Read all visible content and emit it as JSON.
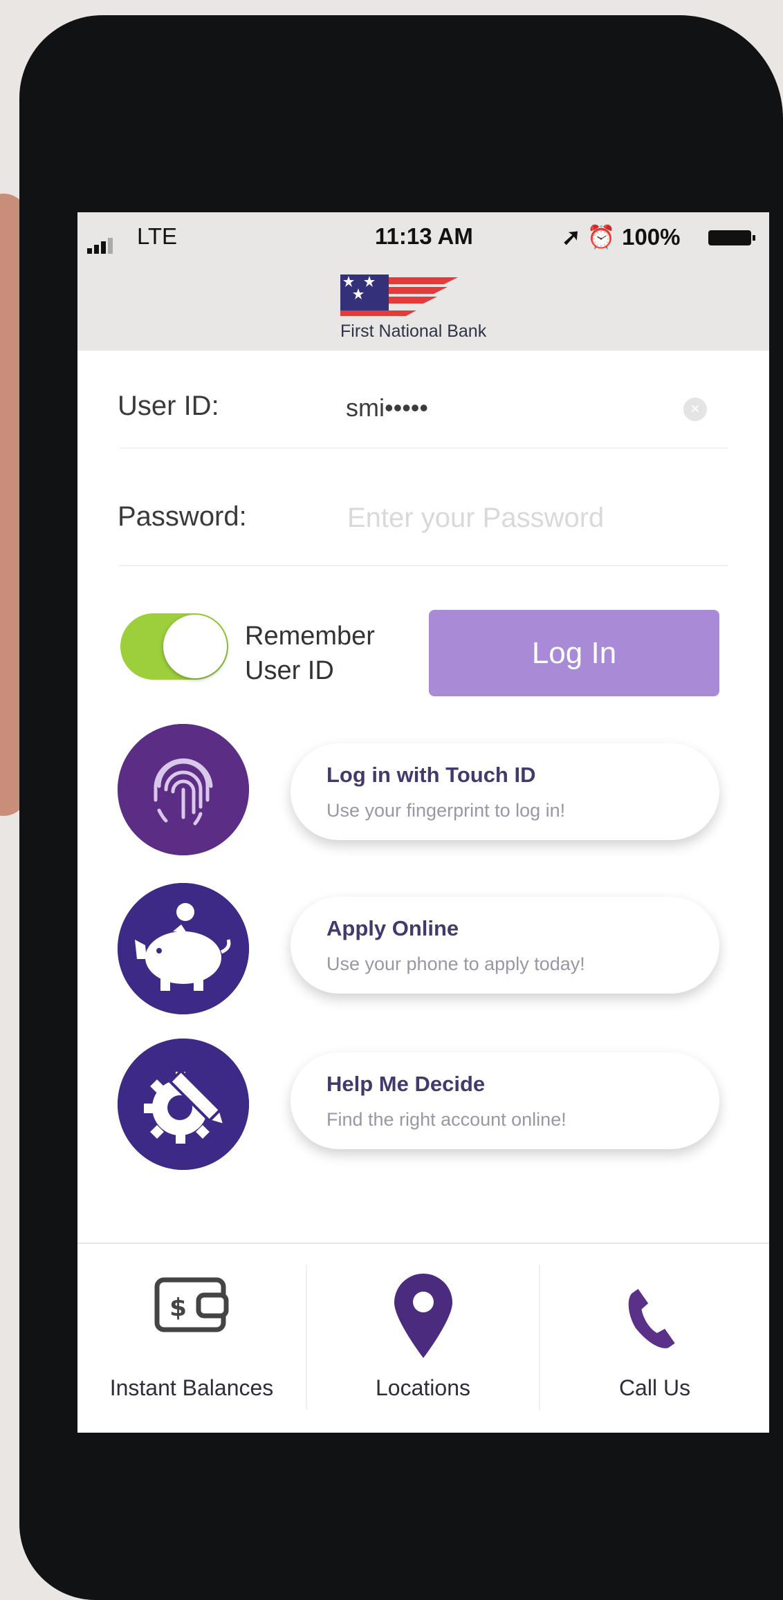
{
  "status_bar": {
    "carrier": "LTE",
    "time": "11:13 AM",
    "battery": "100%"
  },
  "header": {
    "bank_name": "First National Bank"
  },
  "login": {
    "user_id_label": "User ID:",
    "user_id_value": "smi•••••",
    "password_label": "Password:",
    "password_placeholder": "Enter your Password",
    "remember_line1": "Remember",
    "remember_line2": "User ID",
    "remember_on": true,
    "login_button": "Log In"
  },
  "features": [
    {
      "title": "Log in with Touch ID",
      "subtitle": "Use your fingerprint to log in!",
      "icon": "fingerprint-icon"
    },
    {
      "title": "Apply Online",
      "subtitle": "Use your phone to apply today!",
      "icon": "piggy-bank-icon"
    },
    {
      "title": "Help Me Decide",
      "subtitle": "Find the right account online!",
      "icon": "gear-pencil-icon"
    }
  ],
  "tabbar": {
    "items": [
      {
        "label": "Instant Balances",
        "icon": "wallet-icon"
      },
      {
        "label": "Locations",
        "icon": "location-pin-icon"
      },
      {
        "label": "Call Us",
        "icon": "phone-icon"
      }
    ]
  },
  "colors": {
    "accent_purple": "#3d2a86",
    "button_purple": "#a88ad6",
    "toggle_green": "#9ccf3b"
  }
}
